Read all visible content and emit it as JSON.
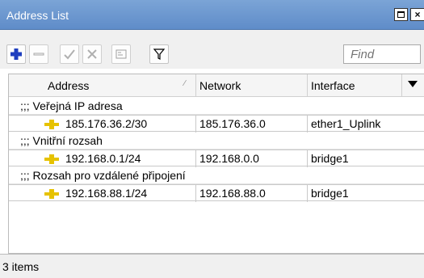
{
  "window": {
    "title": "Address List",
    "maximize_symbol": "□",
    "close_symbol": "×"
  },
  "toolbar": {
    "buttons": [
      {
        "name": "add",
        "icon": "plus-icon",
        "enabled": true
      },
      {
        "name": "remove",
        "icon": "minus-icon",
        "enabled": false
      },
      {
        "name": "enable",
        "icon": "check-icon",
        "enabled": false
      },
      {
        "name": "disable",
        "icon": "cross-icon",
        "enabled": false
      },
      {
        "name": "comment",
        "icon": "note-icon",
        "enabled": false
      },
      {
        "name": "filter",
        "icon": "funnel-icon",
        "enabled": true
      }
    ],
    "find_placeholder": "Find"
  },
  "table": {
    "columns": [
      "Address",
      "Network",
      "Interface"
    ],
    "groups": [
      {
        "comment": ";;; Veřejná IP adresa",
        "address": "185.176.36.2/30",
        "network": "185.176.36.0",
        "interface": "ether1_Uplink"
      },
      {
        "comment": ";;; Vnitřní rozsah",
        "address": "192.168.0.1/24",
        "network": "192.168.0.0",
        "interface": "bridge1"
      },
      {
        "comment": ";;; Rozsah pro vzdálené připojení",
        "address": "192.168.88.1/24",
        "network": "192.168.88.0",
        "interface": "bridge1"
      }
    ]
  },
  "status": {
    "items_count": "3 items"
  },
  "colors": {
    "titlebar": "#6a96cf",
    "add_icon": "#1f3fbf",
    "address_icon": "#e6c200"
  }
}
